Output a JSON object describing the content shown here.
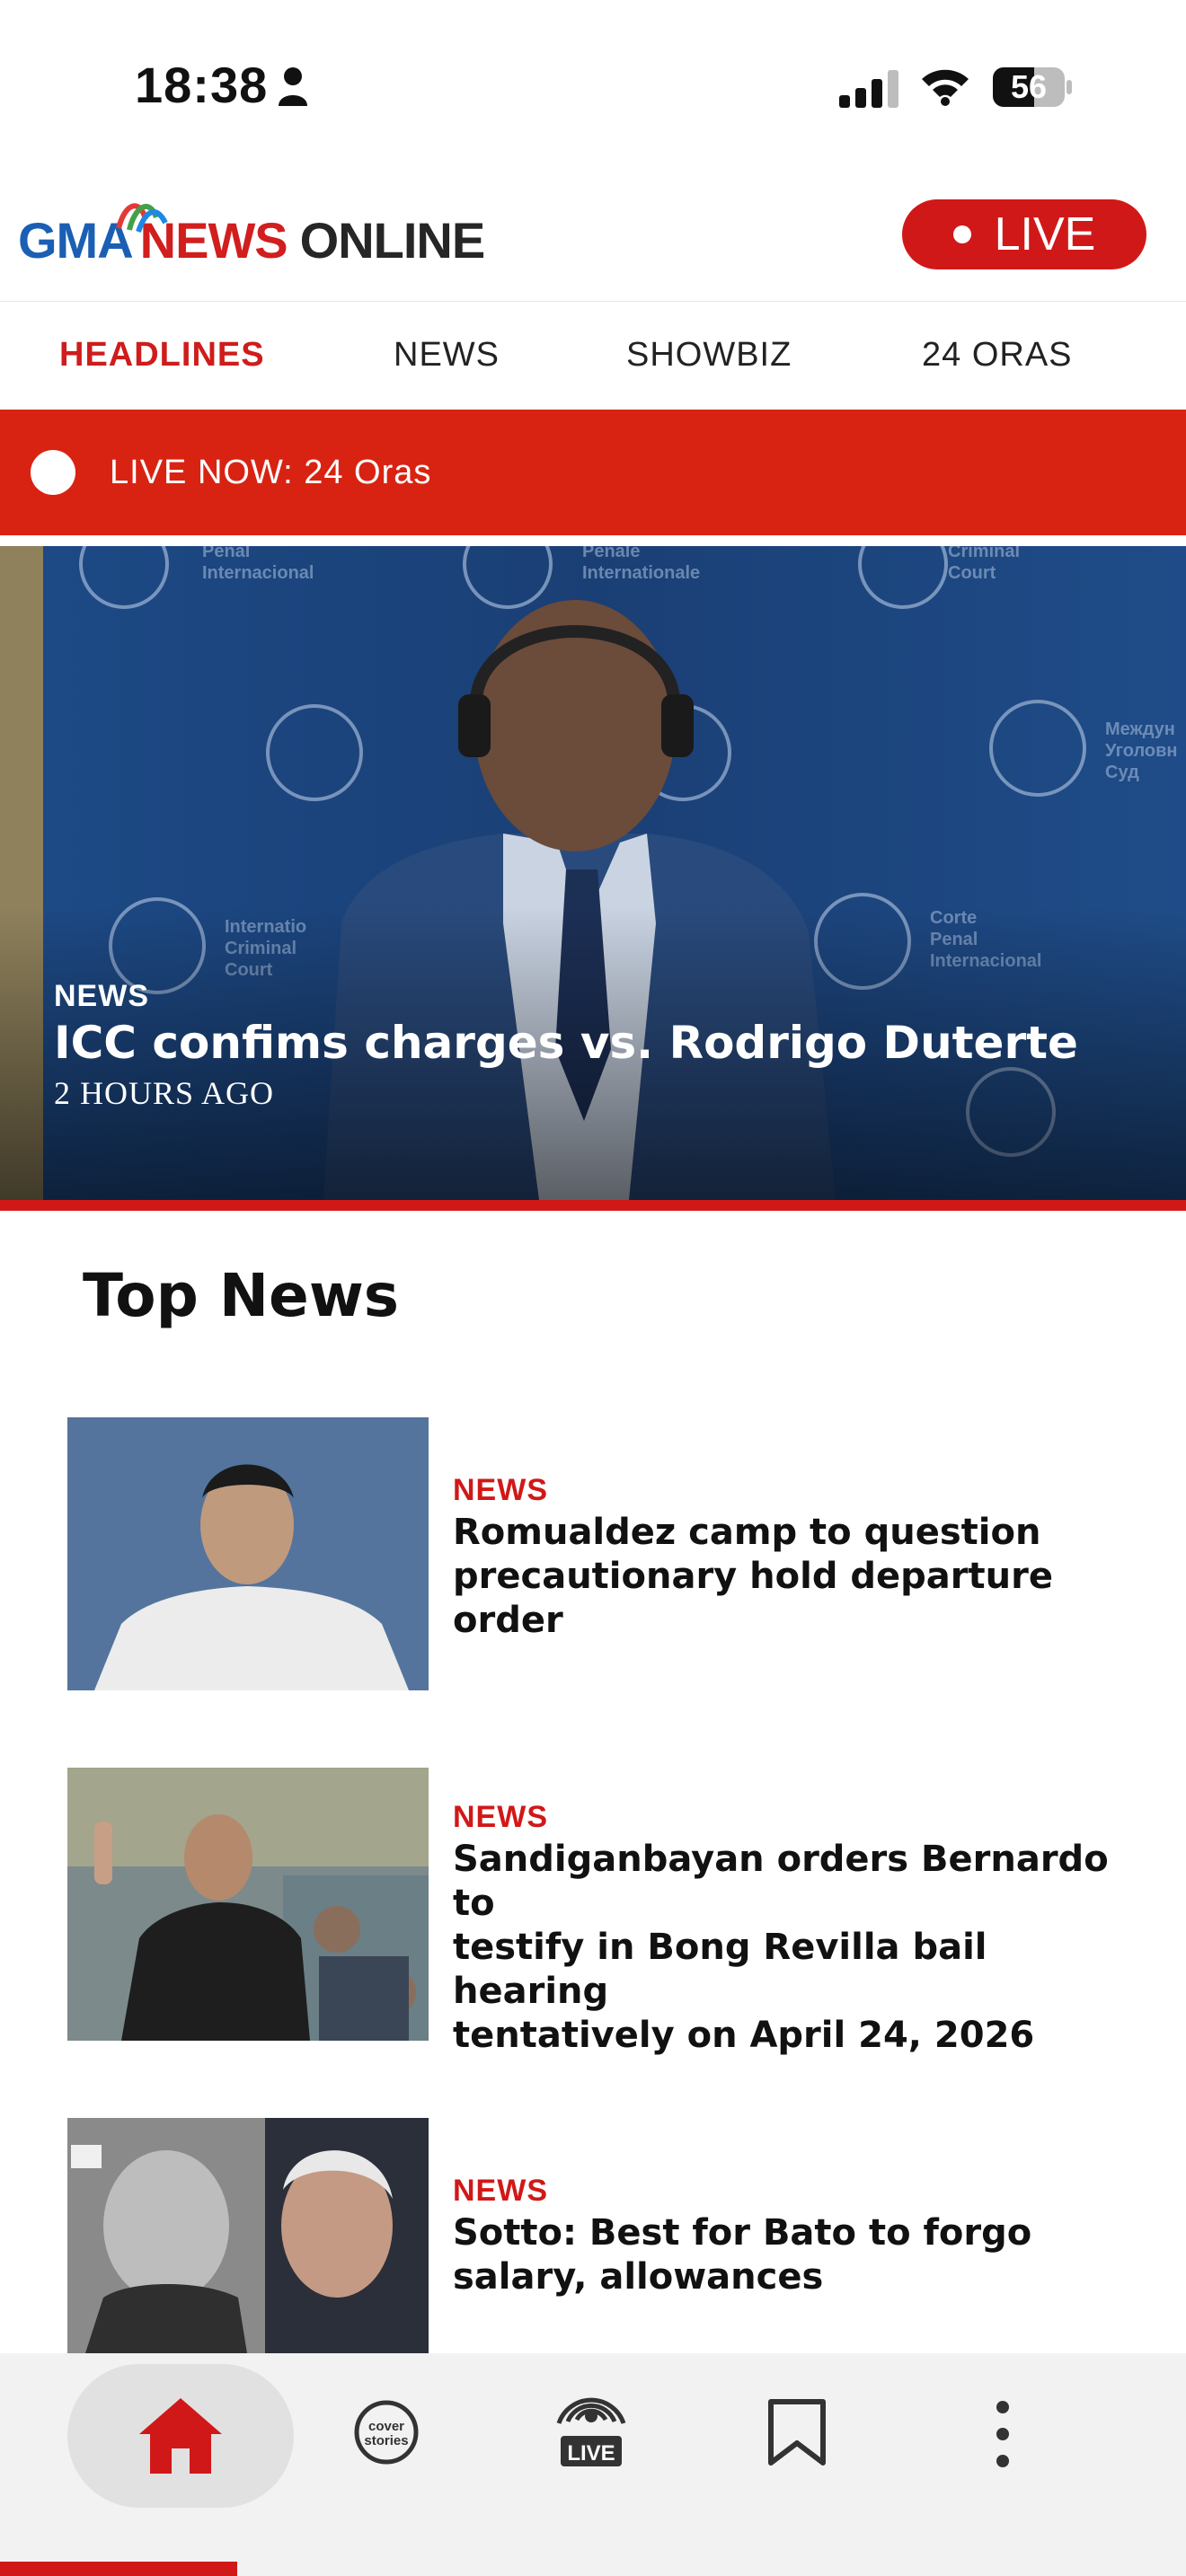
{
  "status_bar": {
    "time": "18:38",
    "battery": "56"
  },
  "header": {
    "logo_gma": "GMA",
    "logo_news": "NEWS",
    "logo_online": "ONLINE",
    "live_label": "LIVE"
  },
  "tabs": [
    {
      "label": "HEADLINES",
      "active": true
    },
    {
      "label": "NEWS",
      "active": false
    },
    {
      "label": "SHOWBIZ",
      "active": false
    },
    {
      "label": "24 ORAS",
      "active": false
    }
  ],
  "live_banner": {
    "text": "LIVE NOW: 24 Oras"
  },
  "hero": {
    "category": "NEWS",
    "title": "ICC confims charges vs. Rodrigo Duterte",
    "time": "2 HOURS AGO"
  },
  "top_news": {
    "title": "Top News",
    "items": [
      {
        "category": "NEWS",
        "title_lines": [
          "Romualdez camp to question",
          "precautionary hold departure order"
        ]
      },
      {
        "category": "NEWS",
        "title_lines": [
          "Sandiganbayan orders Bernardo to",
          "testify in Bong Revilla bail hearing",
          "tentatively on April 24, 2026"
        ]
      },
      {
        "category": "NEWS",
        "title_lines": [
          "Sotto: Best for Bato to forgo",
          "salary, allowances"
        ]
      }
    ]
  },
  "bottom_nav": {
    "items": [
      {
        "icon": "home-icon",
        "active": true
      },
      {
        "icon": "cover-stories-icon",
        "label": "cover stories"
      },
      {
        "icon": "live-broadcast-icon",
        "label": "LIVE"
      },
      {
        "icon": "bookmark-icon"
      },
      {
        "icon": "more-vertical-icon"
      }
    ]
  },
  "colors": {
    "accent_red": "#d11818",
    "banner_red": "#d92312",
    "logo_blue": "#1a5fb4"
  }
}
